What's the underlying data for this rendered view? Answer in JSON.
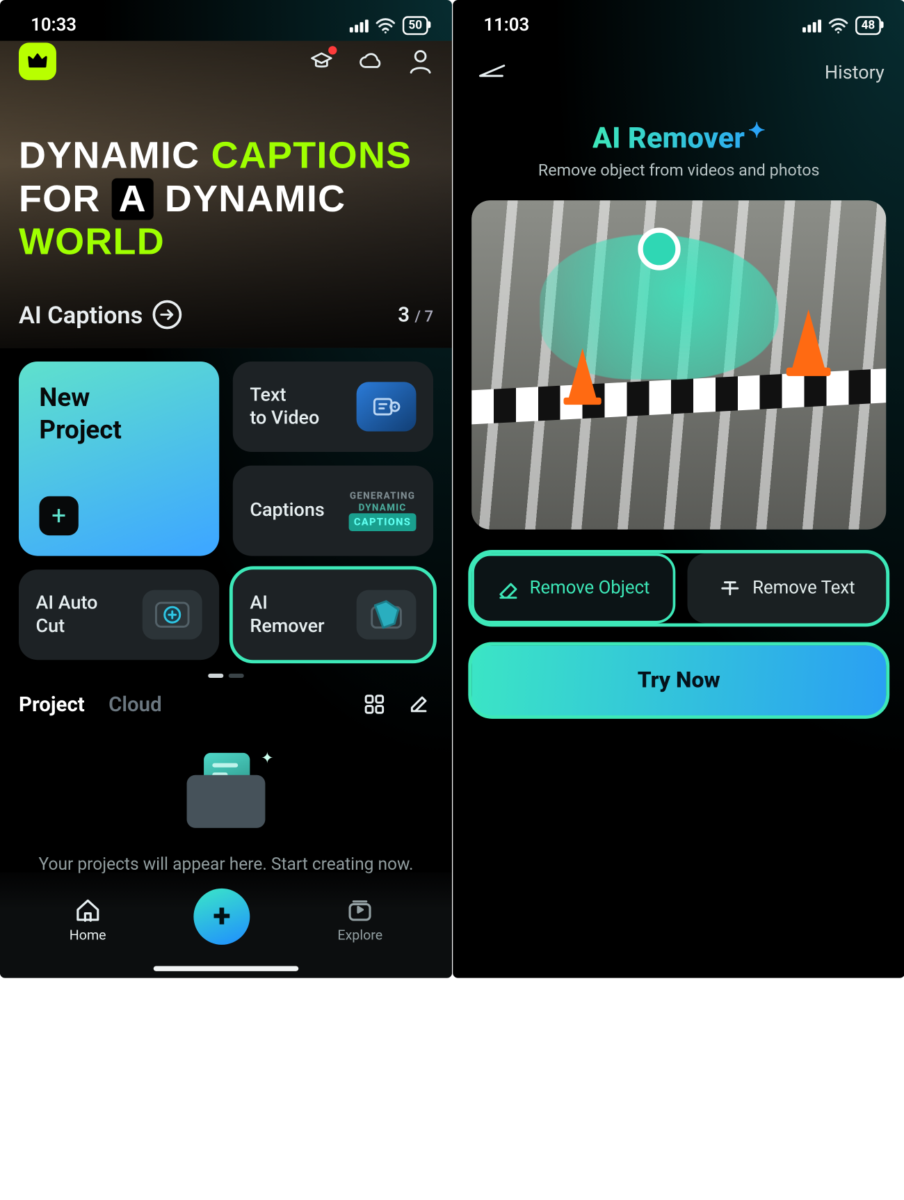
{
  "left": {
    "status": {
      "time": "10:33",
      "battery": "50"
    },
    "hero": {
      "line1_a": "DYNAMIC",
      "line1_b": "CAPTIONS",
      "line2_a": "FOR",
      "line2_b": "A",
      "line2_c": "DYNAMIC",
      "line2_d": "WORLD"
    },
    "feature": {
      "title": "AI Captions",
      "current": "3",
      "total": "/ 7"
    },
    "cards": {
      "new_project": "New\nProject",
      "text_to_video": "Text\nto Video",
      "captions": "Captions",
      "captions_badge_line1": "GENERATING",
      "captions_badge_line2": "DYNAMIC",
      "captions_badge_chip": "CAPTIONS",
      "ai_auto_cut": "AI Auto\nCut",
      "ai_remover": "AI\nRemover"
    },
    "tabs": {
      "project": "Project",
      "cloud": "Cloud"
    },
    "empty_message": "Your projects will appear here. Start creating now.",
    "nav": {
      "home": "Home",
      "explore": "Explore"
    }
  },
  "right": {
    "status": {
      "time": "11:03",
      "battery": "48"
    },
    "header": {
      "history": "History"
    },
    "title": "AI Remover",
    "subtitle": "Remove object from videos and photos",
    "modes": {
      "remove_object": "Remove Object",
      "remove_text": "Remove Text"
    },
    "cta": "Try Now"
  }
}
